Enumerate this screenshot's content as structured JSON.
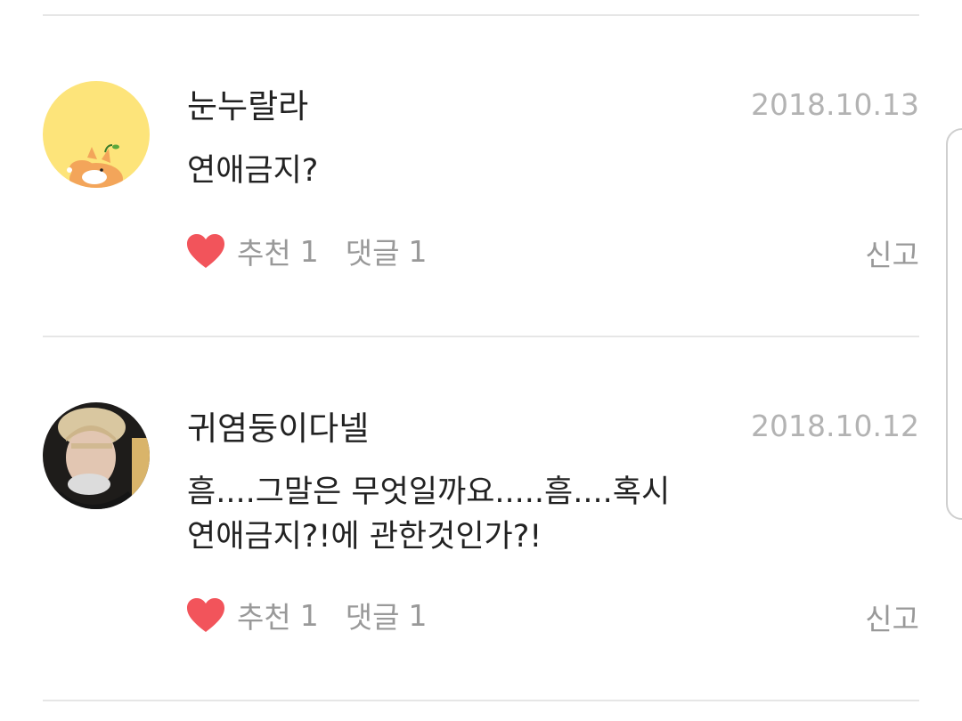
{
  "comments": [
    {
      "username": "눈누랄라",
      "date": "2018.10.13",
      "text": "연애금지?",
      "like_label": "추천",
      "like_count": "1",
      "reply_label": "댓글",
      "reply_count": "1",
      "report_label": "신고",
      "avatar_icon": "corgi-character-avatar"
    },
    {
      "username": "귀염둥이다넬",
      "date": "2018.10.12",
      "text": "흠....그말은 무엇일까요.....흠....혹시\n연애금지?!에 관한것인가?!",
      "like_label": "추천",
      "like_count": "1",
      "reply_label": "댓글",
      "reply_count": "1",
      "report_label": "신고",
      "avatar_icon": "person-photo-avatar"
    }
  ],
  "colors": {
    "heart": "#f2545b",
    "muted_text": "#999999",
    "date_text": "#b3b3b3",
    "divider": "#e6e6e6",
    "avatar1_bg": "#fde47a"
  }
}
